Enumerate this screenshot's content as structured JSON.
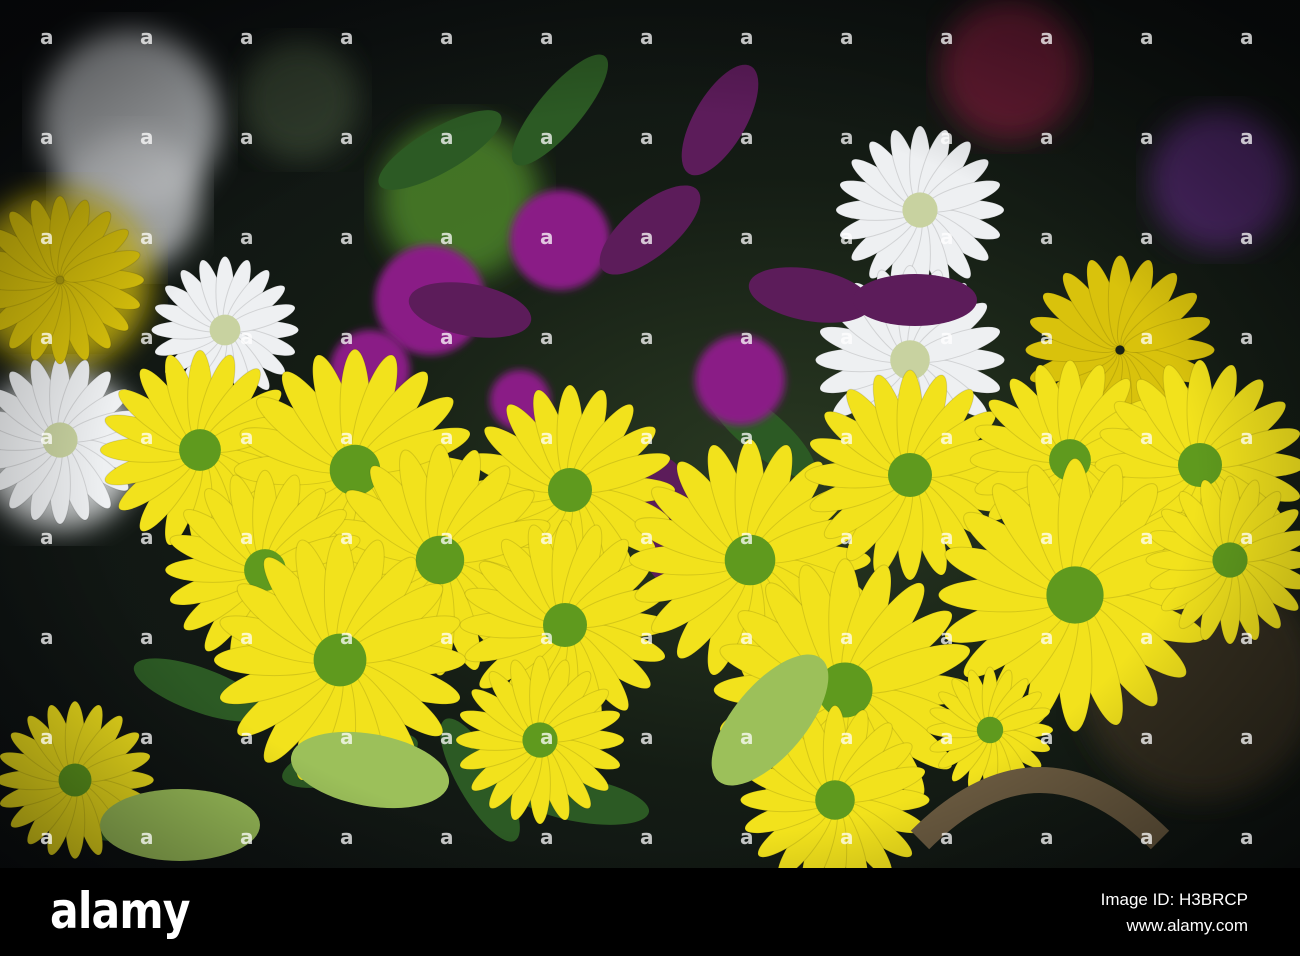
{
  "photo": {
    "subject": "bouquet",
    "colors": {
      "yellow": "#f2e21c",
      "yellow_dark": "#d9c20c",
      "center": "#5f9a1e",
      "white": "#eef0f2",
      "magenta": "#8a1e86",
      "purple_bud": "#5c1c5a",
      "leaf": "#2c5a24"
    }
  },
  "watermark": {
    "glyph": "a",
    "logo_text": "alamy"
  },
  "footer": {
    "logo": "alamy",
    "image_id": "Image ID: H3BRCP",
    "url": "www.alamy.com"
  }
}
